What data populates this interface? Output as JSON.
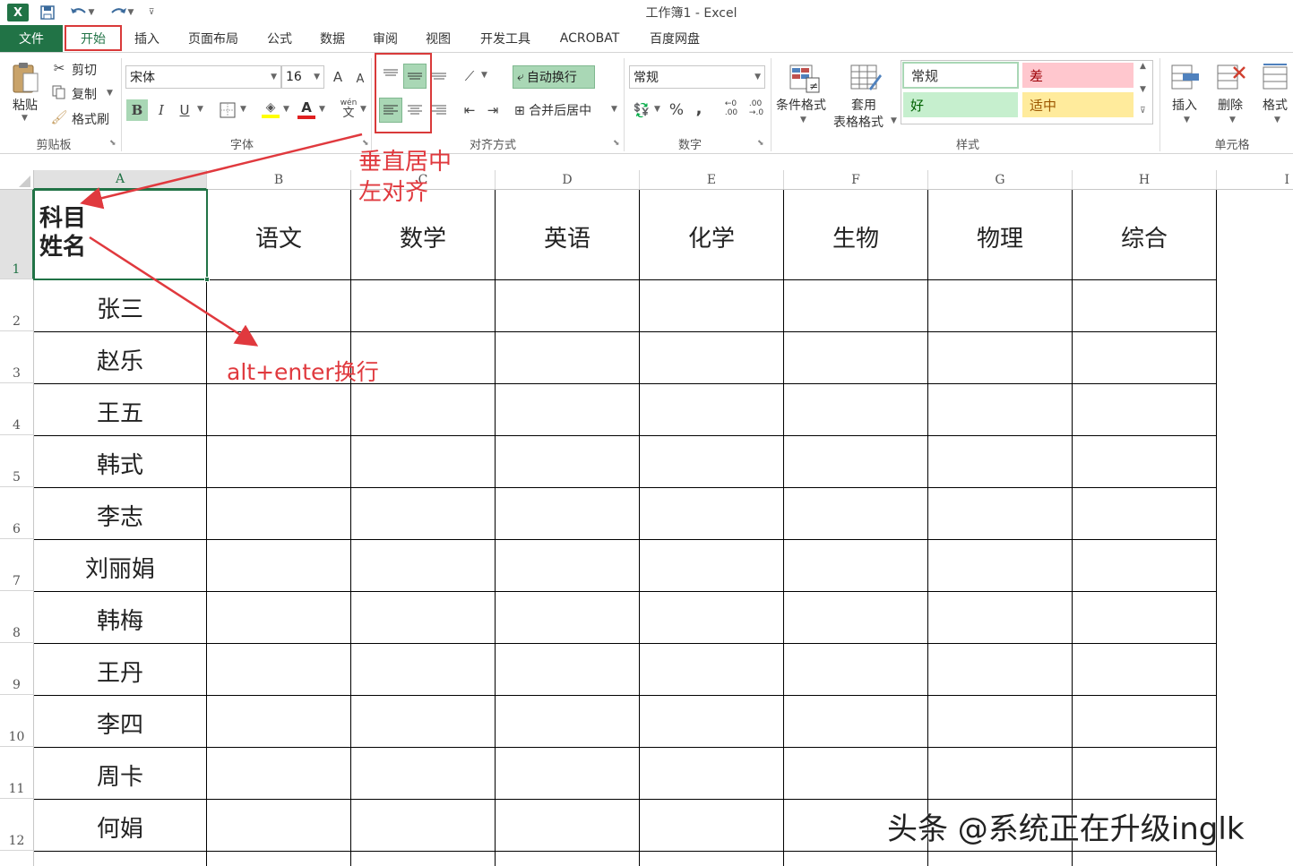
{
  "window": {
    "title": "工作簿1 - Excel",
    "logo": "X"
  },
  "qat": {
    "save_icon": "save-icon",
    "undo_icon": "undo-icon",
    "redo_icon": "redo-icon"
  },
  "tabs": [
    "文件",
    "开始",
    "插入",
    "页面布局",
    "公式",
    "数据",
    "审阅",
    "视图",
    "开发工具",
    "ACROBAT",
    "百度网盘"
  ],
  "ribbon": {
    "clipboard": {
      "paste": "粘贴",
      "cut": "剪切",
      "copy": "复制",
      "format_painter": "格式刷",
      "label": "剪贴板"
    },
    "font": {
      "name": "宋体",
      "size": "16",
      "bold": "B",
      "italic": "I",
      "underline": "U",
      "label": "字体",
      "grow": "A",
      "shrink": "A",
      "color_a": "A",
      "wen": "wén",
      "wen2": "文"
    },
    "alignment": {
      "wrap": "自动换行",
      "merge": "合并后居中",
      "label": "对齐方式"
    },
    "number": {
      "format": "常规",
      "percent": "%",
      "comma": ",",
      "label": "数字",
      "inc": "←0\n.00",
      "dec": ".00\n→.0"
    },
    "styles": {
      "conditional": "条件格式",
      "table_fmt_1": "套用",
      "table_fmt_2": "表格格式",
      "normal": "常规",
      "bad": "差",
      "good": "好",
      "neutral": "适中",
      "label": "样式"
    },
    "cells": {
      "insert": "插入",
      "delete": "删除",
      "format": "格式",
      "label": "单元格"
    }
  },
  "columns": [
    "A",
    "B",
    "C",
    "D",
    "E",
    "F",
    "G",
    "H",
    "I"
  ],
  "rows": [
    "1",
    "2",
    "3",
    "4",
    "5",
    "6",
    "7",
    "8",
    "9",
    "10",
    "11",
    "12"
  ],
  "header_cell": {
    "line1": "科目",
    "line2": "姓名"
  },
  "subjects": [
    "语文",
    "数学",
    "英语",
    "化学",
    "生物",
    "物理",
    "综合"
  ],
  "names": [
    "张三",
    "赵乐",
    "王五",
    "韩式",
    "李志",
    "刘丽娟",
    "韩梅",
    "王丹",
    "李四",
    "周卡",
    "何娟"
  ],
  "annotations": {
    "align_line1": "垂直居中",
    "align_line2": "左对齐",
    "hint": "alt+enter换行"
  },
  "watermark": "头条 @系统正在升级inglk",
  "colors": {
    "excel_green": "#217346",
    "annotation_red": "#e0393e",
    "style_bad_bg": "#ffc7ce",
    "style_good_bg": "#c6efce",
    "style_neutral_bg": "#ffeb9c"
  }
}
